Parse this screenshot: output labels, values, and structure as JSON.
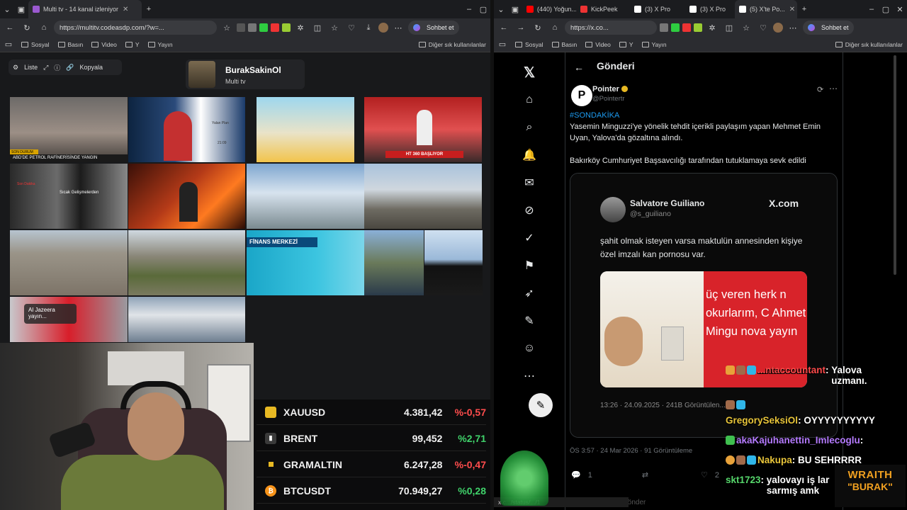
{
  "left_browser": {
    "tabs": [
      {
        "title": "Multi tv - 14 kanal izleniyor",
        "active": true
      }
    ],
    "address": "https://multitv.codeasdp.com/?w=...",
    "chat_button": "Sohbet et",
    "bookmarks": [
      "Sosyal",
      "Basın",
      "Video",
      "Y",
      "Yayın"
    ],
    "other_bookmarks": "Diğer sık kullanılanlar"
  },
  "multitv": {
    "toolbar": {
      "list_label": "Liste",
      "copy_label": "Kopyala"
    },
    "profile": {
      "name": "BurakSakinOl",
      "subtitle": "Multi tv"
    },
    "tiles": [
      {
        "label": "ABD'DE PETROL RAFİNERİSİNDE YANGIN",
        "sub": "SON DURUM"
      },
      {
        "label": "Yalan Plan",
        "sub": "21:09"
      },
      {
        "label": ""
      },
      {
        "label": "HT 360 BAŞLIYOR"
      },
      {
        "label": "Sıcak Gelişmelerden",
        "sub": "Son Dakika"
      },
      {
        "label": ""
      },
      {
        "label": ""
      },
      {
        "label": ""
      },
      {
        "label": ""
      },
      {
        "label": ""
      },
      {
        "label": "FİNANS MERKEZİ"
      },
      {
        "label": ""
      },
      {
        "label": "Al Jazeera yayın..."
      },
      {
        "label": ""
      }
    ]
  },
  "ticker": [
    {
      "name": "XAUUSD",
      "value": "4.381,42",
      "change": "%-0,57",
      "icon_color": "#e8b923",
      "change_color": "#ff4d4d"
    },
    {
      "name": "BRENT",
      "value": "99,452",
      "change": "%2,71",
      "icon_color": "#444444",
      "change_color": "#40d36b"
    },
    {
      "name": "GRAMALTIN",
      "value": "6.247,28",
      "change": "%-0,47",
      "icon_color": "#e8b923",
      "change_color": "#ff4d4d"
    },
    {
      "name": "BTCUSDT",
      "value": "70.949,27",
      "change": "%0,28",
      "icon_color": "#f7931a",
      "change_color": "#40d36b"
    }
  ],
  "right_browser": {
    "tabs": [
      {
        "title": "(440) Yoğun..."
      },
      {
        "title": "KickPeek"
      },
      {
        "title": "(3) X Pro"
      },
      {
        "title": "(3) X Pro"
      },
      {
        "title": "(5) X'te Po...",
        "active": true
      }
    ],
    "address": "https://x.co...",
    "chat_button": "Sohbet et",
    "bookmarks": [
      "Sosyal",
      "Basın",
      "Video",
      "Y",
      "Yayın"
    ],
    "other_bookmarks": "Diğer sık kullanılanlar",
    "status_url": "x.c.../status/.../1"
  },
  "x": {
    "header": "Gönderi",
    "author": {
      "name": "Pointer",
      "handle": "@Pointertr"
    },
    "hashtag": "#SONDAKİKA",
    "text": "Yasemin Minguzzi'ye yönelik tehdit içerikli paylaşım yapan Mehmet Emin Uyan, Yalova'da gözaltına alındı.",
    "text2": "Bakırköy Cumhuriyet Başsavcılığı tarafından tutuklamaya sevk edildi",
    "quoted": {
      "name": "Salvatore Guiliano",
      "handle": "@s_guiliano",
      "brand": "X.com",
      "text": "şahit olmak isteyen varsa maktulün annesinden kişiye özel imzalı kan pornosu var.",
      "img_text": "üç veren herk n okurlarım, C Ahmet Mingu nova yayın",
      "time": "13:26 · 24.09.2025 · 241B Görüntülen..."
    },
    "meta": "ÖS 3:57 · 24 Mar 2026 · 91 Görüntüleme",
    "reply_count": "1",
    "like_count": "2",
    "reply_placeholder": "Gönder"
  },
  "chat": [
    {
      "user": "...ntaccountant",
      "msg": "Yalova uzmanı.",
      "color": "#ff4b4b"
    },
    {
      "user": "GregorySeksiOl",
      "msg": "OYYYYYYYYYY",
      "color": "#e8c53a"
    },
    {
      "user": "akaKajuhanettin_Imlecoglu",
      "msg": "",
      "color": "#b57bff"
    },
    {
      "user": "Nakupa",
      "msg": "BU SEHRRRR",
      "color": "#e8c53a"
    },
    {
      "user": "skt1723",
      "msg": "yalovayı iş lar sarmış amk",
      "color": "#56d66b"
    }
  ],
  "logo": {
    "line1": "WRAITH",
    "line2": "\"BURAK\""
  }
}
